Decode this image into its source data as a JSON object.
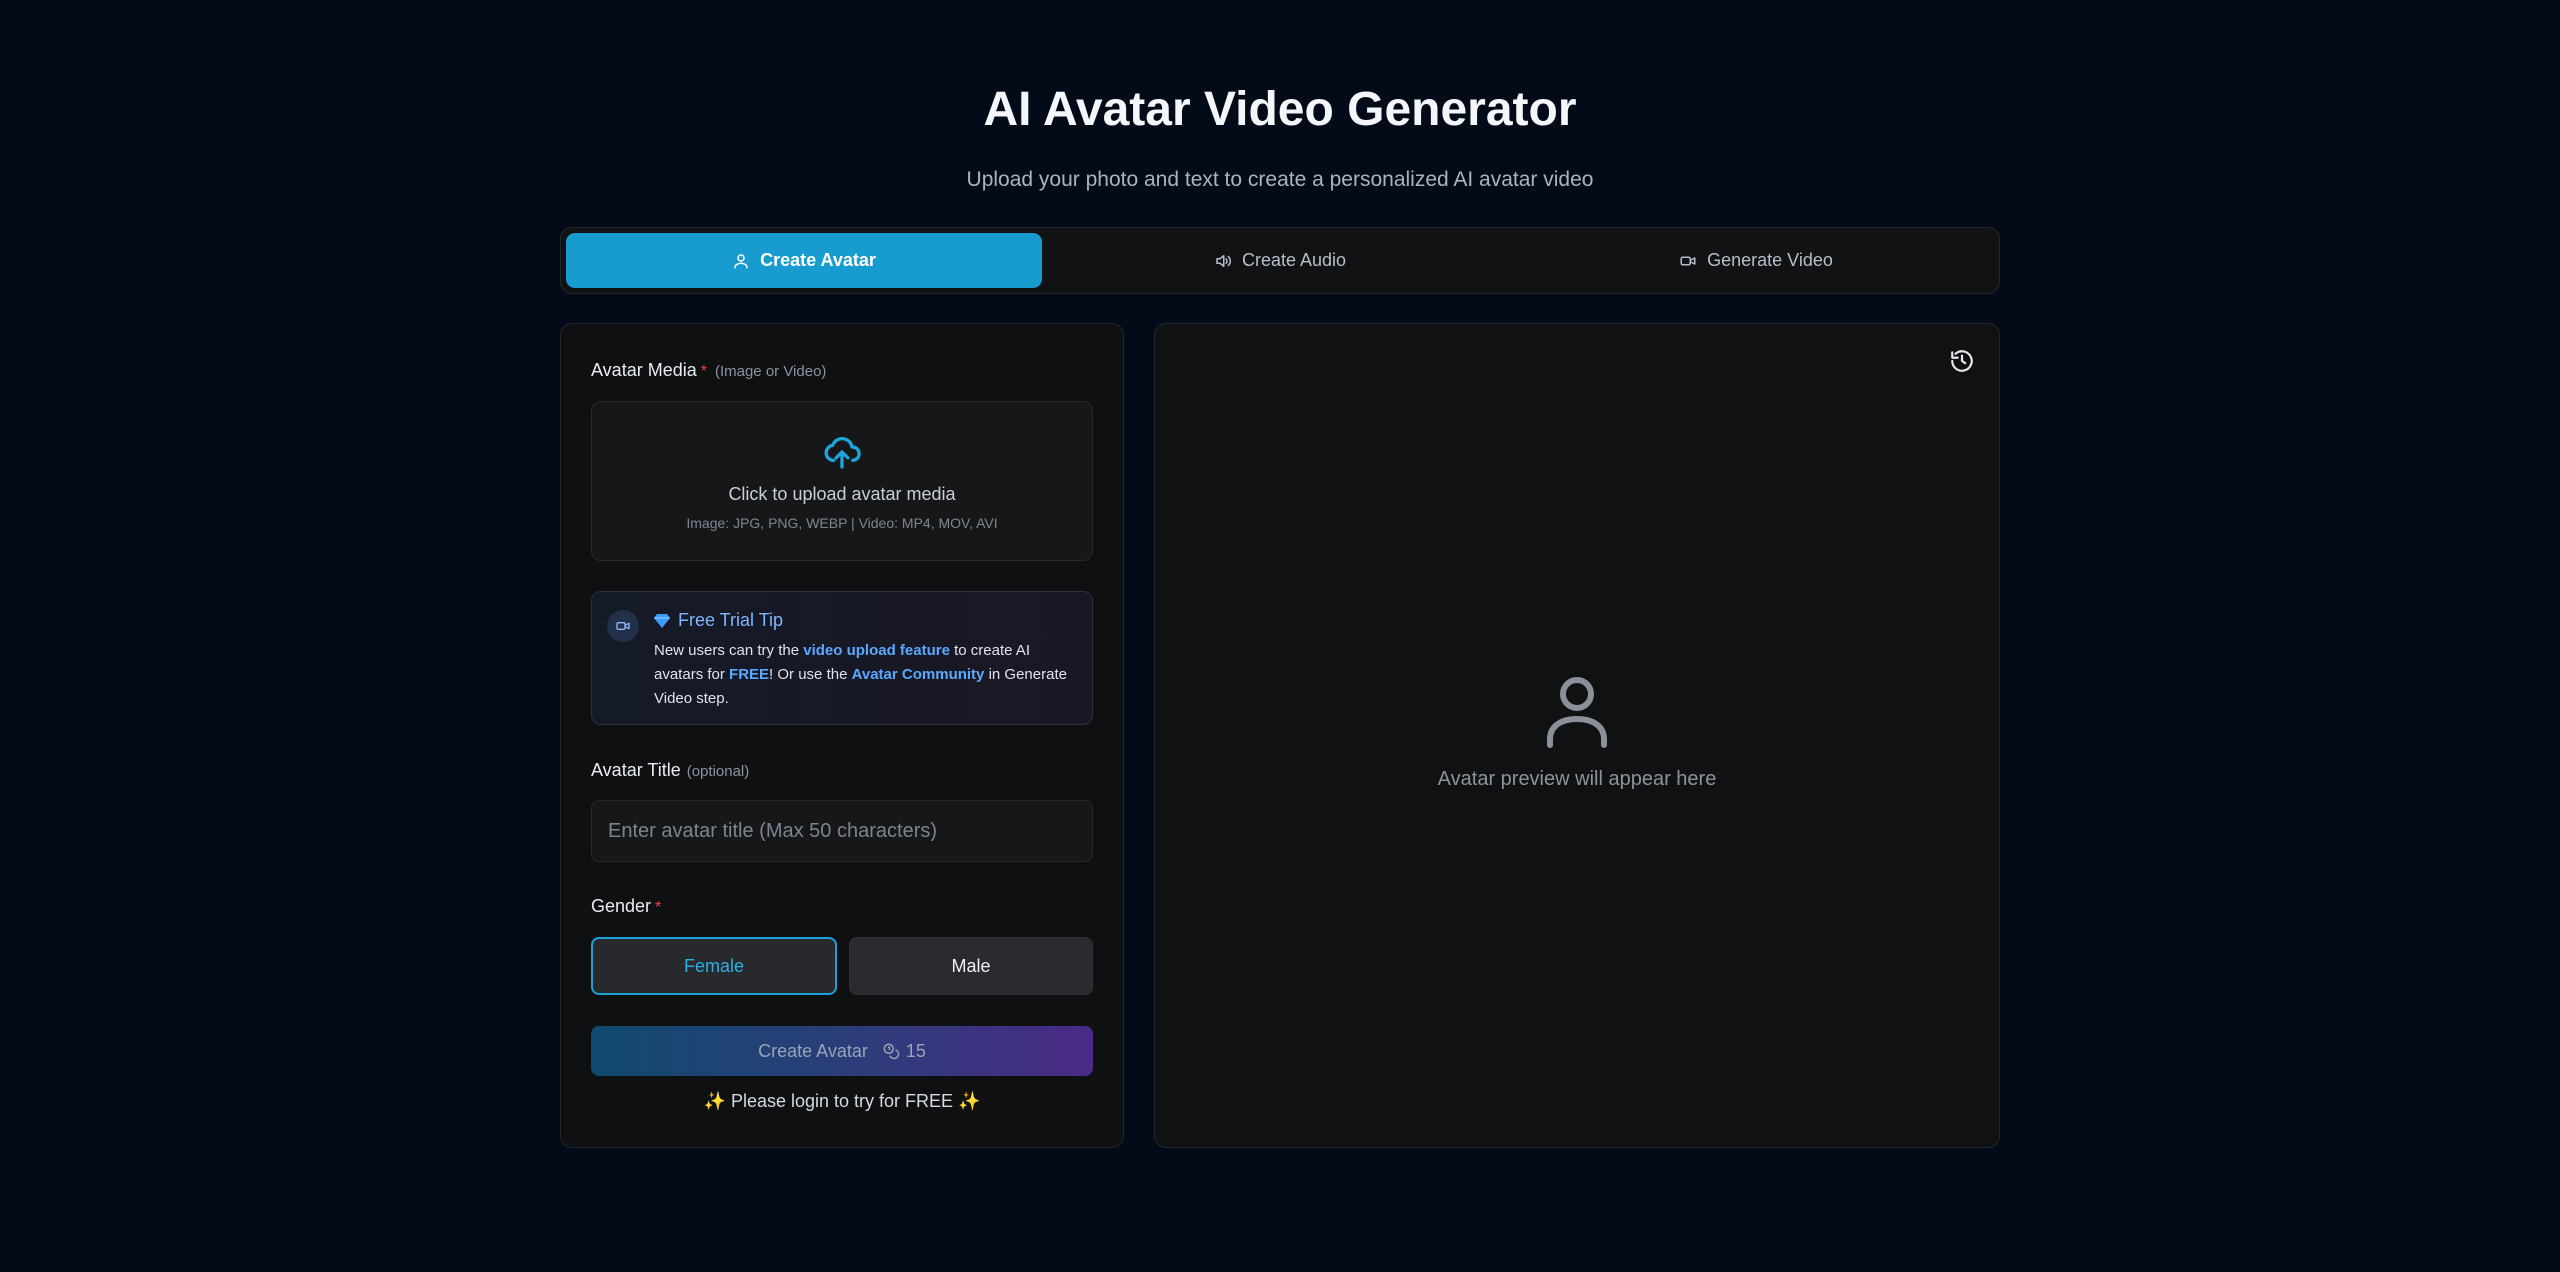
{
  "header": {
    "title": "AI Avatar Video Generator",
    "subtitle": "Upload your photo and text to create a personalized AI avatar video"
  },
  "tabs": [
    {
      "label": "Create Avatar",
      "icon": "user-icon",
      "active": true
    },
    {
      "label": "Create Audio",
      "icon": "speaker-icon",
      "active": false
    },
    {
      "label": "Generate Video",
      "icon": "video-camera-icon",
      "active": false
    }
  ],
  "form": {
    "media": {
      "label": "Avatar Media",
      "required_mark": "*",
      "hint": "(Image or Video)",
      "upload_text": "Click to upload avatar media",
      "formats": "Image: JPG, PNG, WEBP | Video: MP4, MOV, AVI"
    },
    "tip": {
      "title": "Free Trial Tip",
      "body_1": "New users can try the ",
      "link_1": "video upload feature",
      "body_2": " to create AI avatars for ",
      "free": "FREE",
      "body_3": "! Or use the ",
      "link_2": "Avatar Community",
      "body_4": " in Generate Video step."
    },
    "avatar_title": {
      "label": "Avatar Title",
      "hint": "(optional)",
      "value": "",
      "placeholder": "Enter avatar title (Max 50 characters)"
    },
    "gender": {
      "label": "Gender",
      "required_mark": "*",
      "options": [
        "Female",
        "Male"
      ],
      "selected": "Female"
    },
    "submit": {
      "label": "Create Avatar",
      "credits": "15"
    },
    "login_note": "✨ Please login to try for FREE ✨"
  },
  "preview": {
    "placeholder": "Avatar preview will appear here"
  },
  "colors": {
    "accent": "#189cd0",
    "background": "#040b18",
    "panel": "#0f1012",
    "required": "#ef4444"
  }
}
